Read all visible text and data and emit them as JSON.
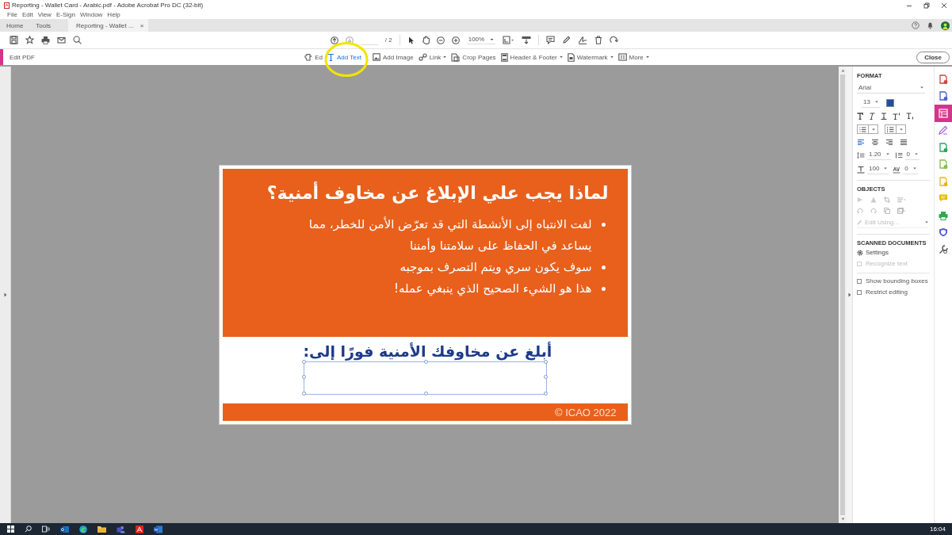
{
  "window": {
    "title": "Reporting - Wallet Card - Arabic.pdf - Adobe Acrobat Pro DC (32-bit)"
  },
  "menu": [
    "File",
    "Edit",
    "View",
    "E-Sign",
    "Window",
    "Help"
  ],
  "tabs": [
    {
      "label": "Home",
      "selected": false
    },
    {
      "label": "Tools",
      "selected": false
    },
    {
      "label": "Reporting - Wallet ...",
      "selected": true,
      "close": "×"
    }
  ],
  "toolbar": {
    "page_total": "/ 2",
    "zoom": "100%"
  },
  "edit_bar": {
    "title": "Edit PDF",
    "close": "Close",
    "tools": [
      {
        "kind": "edit",
        "label": "Ed",
        "selected": false,
        "dropdown": false
      },
      {
        "kind": "text",
        "label": "Add Text",
        "selected": true,
        "dropdown": false
      },
      {
        "kind": "image",
        "label": "Add Image",
        "selected": false,
        "dropdown": false
      },
      {
        "kind": "link",
        "label": "Link",
        "selected": false,
        "dropdown": true
      },
      {
        "kind": "crop",
        "label": "Crop Pages",
        "selected": false,
        "dropdown": false
      },
      {
        "kind": "header",
        "label": "Header & Footer",
        "selected": false,
        "dropdown": true
      },
      {
        "kind": "watermark",
        "label": "Watermark",
        "selected": false,
        "dropdown": true
      },
      {
        "kind": "more",
        "label": "More",
        "selected": false,
        "dropdown": true
      }
    ]
  },
  "document": {
    "heading": "لماذا يجب علي الإبلاغ عن مخاوف أمنية؟",
    "bullets": [
      "لفت الانتباه إلى الأنشطة التي قد تعرّض الأمن للخطر، مما يساعد في الحفاظ على سلامتنا وأمننا",
      "سوف يكون سري ويتم التصرف بموجبه",
      "هذا هو الشيء الصحيح الذي ينبغي عمله!"
    ],
    "prompt": "أبلغ عن مخاوفك الأمنية فورًا إلى:",
    "footer": "© ICAO 2022"
  },
  "format_panel": {
    "heading": "FORMAT",
    "font": "Arial",
    "size": "13",
    "color": "#1f4e9c",
    "alignment": [
      {
        "kind": "left",
        "selected": true
      },
      {
        "kind": "center",
        "selected": false
      },
      {
        "kind": "right",
        "selected": false
      },
      {
        "kind": "justify",
        "selected": false
      }
    ],
    "line_spacing": "1.20",
    "paragraph_spacing": "0",
    "horizontal_scale": "100",
    "character_spacing": "0",
    "objects_heading": "OBJECTS",
    "edit_using": {
      "label": "Edit Using...",
      "disabled": true
    },
    "scanned_heading": "SCANNED DOCUMENTS",
    "settings": "Settings",
    "checkboxes": [
      {
        "label": "Recognize text",
        "checked": false,
        "disabled": true
      },
      {
        "label": "Show bounding boxes",
        "checked": false,
        "disabled": false
      },
      {
        "label": "Restrict editing",
        "checked": false,
        "disabled": false
      }
    ]
  },
  "tool_rail": [
    {
      "kind": "document",
      "color": "#d9403a",
      "selected": false
    },
    {
      "kind": "document",
      "color": "#4a5fd0",
      "selected": false
    },
    {
      "kind": "layout",
      "color": "#d6338a",
      "selected": true
    },
    {
      "kind": "pen",
      "color": "#a35ad8",
      "selected": false
    },
    {
      "kind": "document",
      "color": "#27a65a",
      "selected": false
    },
    {
      "kind": "document",
      "color": "#7cc242",
      "selected": false
    },
    {
      "kind": "document",
      "color": "#e8b417",
      "selected": false
    },
    {
      "kind": "comment",
      "color": "#e6b800",
      "selected": false
    },
    {
      "kind": "printer",
      "color": "#2fa84f",
      "selected": false
    },
    {
      "kind": "shield",
      "color": "#5b5fd6",
      "selected": false
    },
    {
      "kind": "wrench",
      "color": "#555555",
      "selected": false
    }
  ],
  "taskbar": {
    "time": "16:04"
  }
}
